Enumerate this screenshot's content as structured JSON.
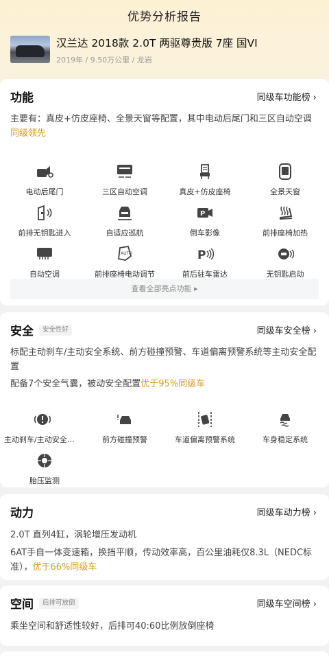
{
  "header": {
    "title": "优势分析报告"
  },
  "car": {
    "name": "汉兰达 2018款 2.0T 两驱尊贵版 7座 国VI",
    "meta": "2019年 / 9.50万公里 / 龙岩"
  },
  "function": {
    "title": "功能",
    "rank_link": "同级车功能榜 ›",
    "desc_main": "主要有：真皮+仿皮座椅、全景天窗等配置，其中电动后尾门和三区自动空调",
    "desc_hl": "同级领先",
    "items": [
      {
        "label": "电动后尾门",
        "icon": "power-tailgate-icon"
      },
      {
        "label": "三区自动空调",
        "icon": "climate-control-icon"
      },
      {
        "label": "真皮+仿皮座椅",
        "icon": "leather-seat-icon"
      },
      {
        "label": "全景天窗",
        "icon": "panoramic-sunroof-icon"
      },
      {
        "label": "前排无钥匙进入",
        "icon": "keyless-entry-icon"
      },
      {
        "label": "自适应巡航",
        "icon": "adaptive-cruise-icon"
      },
      {
        "label": "倒车影像",
        "icon": "reverse-camera-icon"
      },
      {
        "label": "前排座椅加热",
        "icon": "seat-heating-icon"
      },
      {
        "label": "自动空调",
        "icon": "auto-ac-icon"
      },
      {
        "label": "前排座椅电动调节",
        "icon": "power-seat-icon"
      },
      {
        "label": "前后驻车雷达",
        "icon": "parking-radar-icon"
      },
      {
        "label": "无钥匙启动",
        "icon": "keyless-start-icon"
      }
    ],
    "view_all": "查看全部亮点功能 ▸"
  },
  "safety": {
    "title": "安全",
    "badge": "安全性好",
    "rank_link": "同级车安全榜 ›",
    "desc1": "标配主动刹车/主动安全系统、前方碰撞预警、车道偏离预警系统等主动安全配置",
    "desc2_main": "配备7个安全气囊，被动安全配置",
    "desc2_hl": "优于95%同级车",
    "items": [
      {
        "label": "主动刹车/主动安全系统",
        "icon": "active-brake-icon"
      },
      {
        "label": "前方碰撞预警",
        "icon": "collision-warning-icon"
      },
      {
        "label": "车道偏离预警系统",
        "icon": "lane-departure-icon"
      },
      {
        "label": "车身稳定系统",
        "icon": "stability-control-icon"
      },
      {
        "label": "胎压监测",
        "icon": "tire-pressure-icon"
      }
    ]
  },
  "power": {
    "title": "动力",
    "rank_link": "同级车动力榜 ›",
    "desc1": "2.0T 直列4缸，涡轮增压发动机",
    "desc2_main": "6AT手自一体变速箱，换挡平顺，传动效率高，百公里油耗仅8.3L（NEDC标准），",
    "desc2_hl": "优于66%同级车"
  },
  "space": {
    "title": "空间",
    "badge": "后排可放倒",
    "rank_link": "同级车空间榜 ›",
    "desc": "乘坐空间和舒适性较好，后排可40:60比例放倒座椅"
  },
  "colors": {
    "highlight": "#d99a1e",
    "icon": "#444444"
  }
}
